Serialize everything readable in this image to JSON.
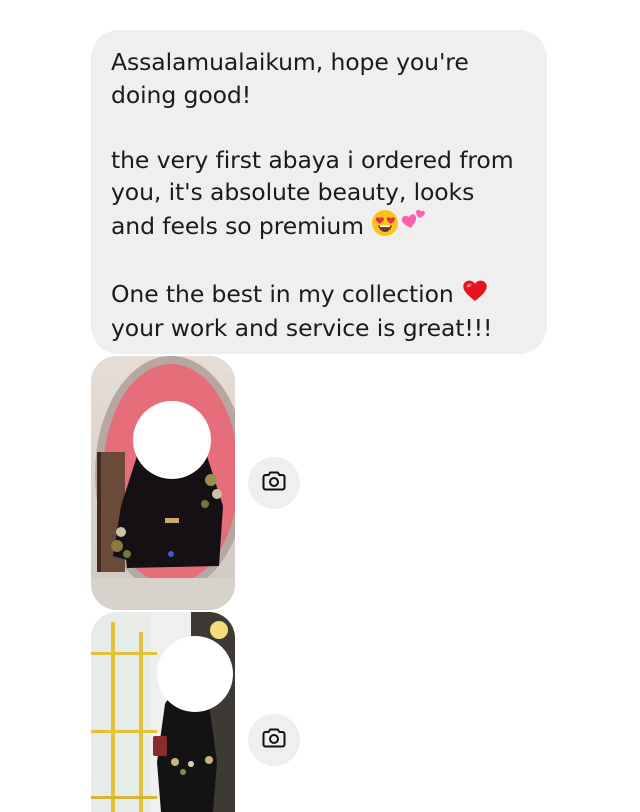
{
  "message": {
    "paragraph_1": [
      "Assalamualaikum, hope you're",
      "doing good!"
    ],
    "paragraph_2": [
      "the very first abaya i ordered from",
      "you, it's absolute beauty, looks",
      "and feels so premium "
    ],
    "paragraph_2_emojis": [
      "heart-eyes-emoji",
      "two-hearts-emoji"
    ],
    "paragraph_3": [
      "One the best in my collection ",
      "your work and service is great!!!"
    ],
    "paragraph_3_emoji": "red-heart-emoji",
    "bubble_color": "#efefef",
    "text_color": "#1b1b1b"
  },
  "attachments": [
    {
      "type": "photo",
      "icon": "camera-icon"
    },
    {
      "type": "photo",
      "icon": "camera-icon"
    }
  ]
}
